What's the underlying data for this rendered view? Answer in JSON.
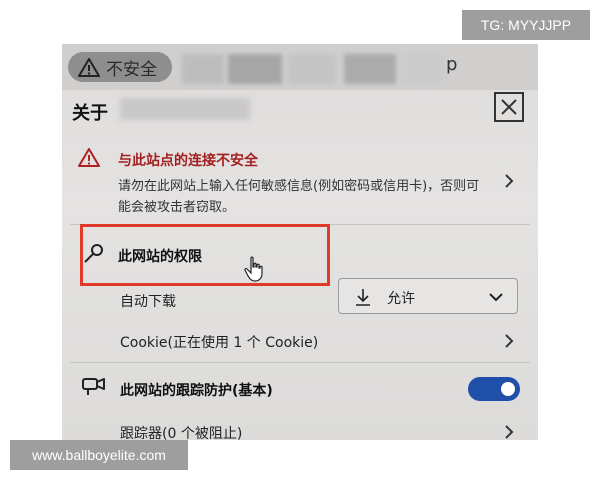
{
  "address_bar": {
    "security_status": "不安全",
    "url_tail": "p"
  },
  "panel": {
    "about_label": "关于",
    "warning": {
      "title": "与此站点的连接不安全",
      "description": "请勿在此网站上输入任何敏感信息(例如密码或信用卡)，否则可能会被攻击者窃取。"
    },
    "permissions_label": "此网站的权限",
    "auto_download": {
      "label": "自动下载",
      "selected_value": "允许"
    },
    "cookie_label": "Cookie(正在使用 1 个 Cookie)",
    "tracking_prevention": {
      "label": "此网站的跟踪防护(基本)",
      "enabled": true
    },
    "trackers_label": "跟踪器(0 个被阻止)"
  },
  "watermarks": {
    "top_right": "TG: MYYJJPP",
    "bottom_left": "www.ballboyelite.com"
  },
  "colors": {
    "warning_text": "#a32020",
    "highlight_box": "#e03a2b",
    "toggle_on": "#1f4fa8",
    "security_pill": "#8e8e8e"
  },
  "icons": [
    "warning-triangle-icon",
    "close-icon",
    "chevron-right-icon",
    "key-icon",
    "download-icon",
    "chevron-down-icon",
    "tracking-icon",
    "hand-cursor-icon"
  ]
}
